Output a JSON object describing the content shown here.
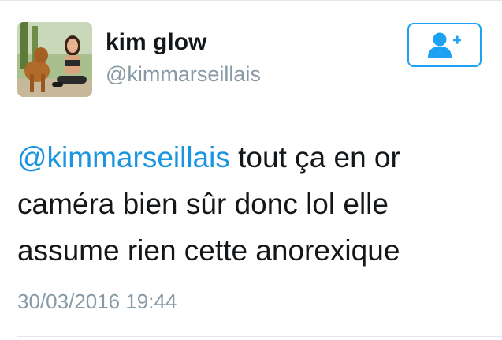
{
  "user": {
    "display_name": "kim glow",
    "handle": "@kimmarseillais",
    "avatar_icon": "profile-photo-woman-with-dog"
  },
  "follow_button": {
    "icon": "add-user-icon"
  },
  "tweet": {
    "mention": "@kimmarseillais",
    "line1_rest": " tout ça en or",
    "line2": "caméra bien sûr donc lol elle",
    "line3": "assume rien cette anorexique",
    "timestamp": "30/03/2016 19:44"
  },
  "colors": {
    "accent": "#1da1f2",
    "mention": "#1b95e0",
    "secondary_text": "#8899a6",
    "primary_text": "#14171a"
  }
}
